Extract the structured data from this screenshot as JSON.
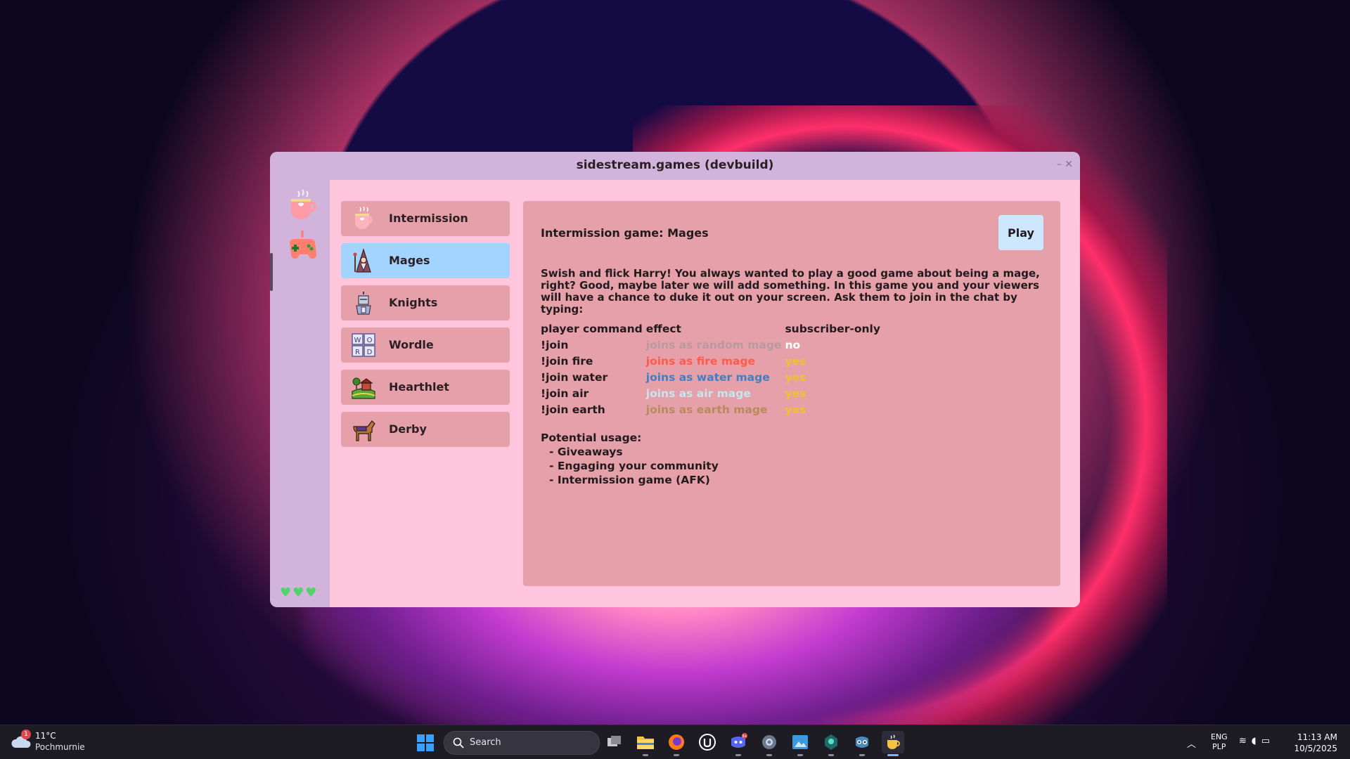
{
  "window": {
    "title": "sidestream.games (devbuild)",
    "minimize": "–",
    "close": "✕"
  },
  "rail": {
    "items": [
      {
        "name": "intermission-cup-icon"
      },
      {
        "name": "gamepad-icon"
      }
    ],
    "hearts": "♥♥♥"
  },
  "games": [
    {
      "label": "Intermission",
      "icon": "cup-icon",
      "selected": false
    },
    {
      "label": "Mages",
      "icon": "mage-icon",
      "selected": true
    },
    {
      "label": "Knights",
      "icon": "knight-icon",
      "selected": false
    },
    {
      "label": "Wordle",
      "icon": "wordle-icon",
      "selected": false
    },
    {
      "label": "Hearthlet",
      "icon": "farm-icon",
      "selected": false
    },
    {
      "label": "Derby",
      "icon": "horse-icon",
      "selected": false
    }
  ],
  "panel": {
    "title": "Intermission game:  Mages",
    "play_label": "Play",
    "description": "Swish and flick Harry! You always wanted to play a good game about being a mage, right? Good, maybe later we will add something. In this game you and your viewers will have a chance to duke it out on your screen. Ask them to join in the chat by typing:",
    "table_headers": [
      "player command",
      "effect",
      "subscriber-only"
    ],
    "commands": [
      {
        "command": "!join",
        "effect": "joins as random mage",
        "effect_color": "#b89a9e",
        "sub": "no",
        "sub_color": "#ffffff"
      },
      {
        "command": "!join fire",
        "effect": "joins as fire mage",
        "effect_color": "#ff5a4a",
        "sub": "yes",
        "sub_color": "#f2c12e"
      },
      {
        "command": "!join water",
        "effect": "joins as water mage",
        "effect_color": "#3f7fc4",
        "sub": "yes",
        "sub_color": "#f2c12e"
      },
      {
        "command": "!join air",
        "effect": "joins as air mage",
        "effect_color": "#c8e4ee",
        "sub": "yes",
        "sub_color": "#f2c12e"
      },
      {
        "command": "!join earth",
        "effect": "joins as earth mage",
        "effect_color": "#b88a5c",
        "sub": "yes",
        "sub_color": "#f2c12e"
      }
    ],
    "usage_title": "Potential usage:",
    "usage_items": [
      "- Giveaways",
      "- Engaging your community",
      "- Intermission game (AFK)"
    ]
  },
  "taskbar": {
    "weather_temp": "11°C",
    "weather_desc": "Pochmurnie",
    "weather_badge": "1",
    "search_placeholder": "Search",
    "apps": [
      {
        "name": "task-view-icon",
        "active": false
      },
      {
        "name": "file-explorer-icon",
        "active": false
      },
      {
        "name": "firefox-icon",
        "active": false
      },
      {
        "name": "unreal-engine-icon",
        "active": false
      },
      {
        "name": "discord-icon",
        "active": false,
        "badge": "9+"
      },
      {
        "name": "settings-icon",
        "active": false
      },
      {
        "name": "image-editor-icon",
        "active": false
      },
      {
        "name": "app-icon",
        "active": false
      },
      {
        "name": "godot-icon",
        "active": false
      },
      {
        "name": "sidestream-icon",
        "active": true
      }
    ],
    "lang_top": "ENG",
    "lang_bottom": "PLP",
    "time": "11:13 AM",
    "date": "10/5/2025"
  }
}
